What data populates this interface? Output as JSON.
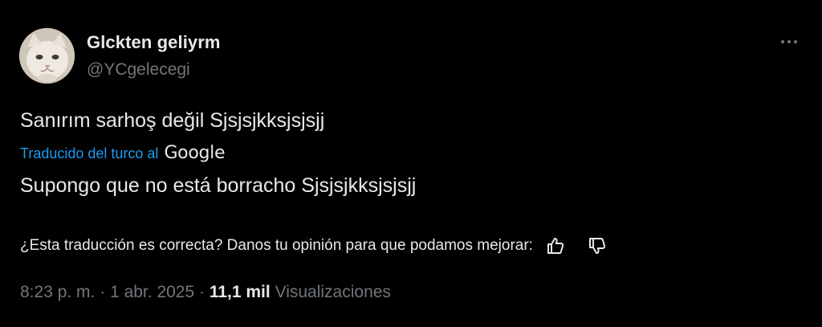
{
  "author": {
    "display_name": "Glckten geliyrm",
    "handle": "@YCgelecegi",
    "avatar_icon": "cat-avatar"
  },
  "menu": {
    "icon": "more-horizontal-icon"
  },
  "tweet": {
    "text": "Sanırım sarhoş değil Sjsjsjkksjsjsjj",
    "translation_label": "Traducido del turco al",
    "translation_provider": "Google",
    "translated_text": "Supongo que no está borracho Sjsjsjkksjsjsjj"
  },
  "feedback": {
    "question": "¿Esta traducción es correcta? Danos tu opinión para que podamos mejorar:",
    "thumbs_up_icon": "thumbs-up-icon",
    "thumbs_down_icon": "thumbs-down-icon"
  },
  "meta": {
    "time": "8:23 p. m.",
    "separator": " · ",
    "date": "1 abr. 2025",
    "views_count": "11,1 mil",
    "views_label": "Visualizaciones"
  },
  "colors": {
    "background": "#000000",
    "text_primary": "#e7e9ea",
    "text_secondary": "#71767b",
    "link": "#1d9bf0"
  }
}
